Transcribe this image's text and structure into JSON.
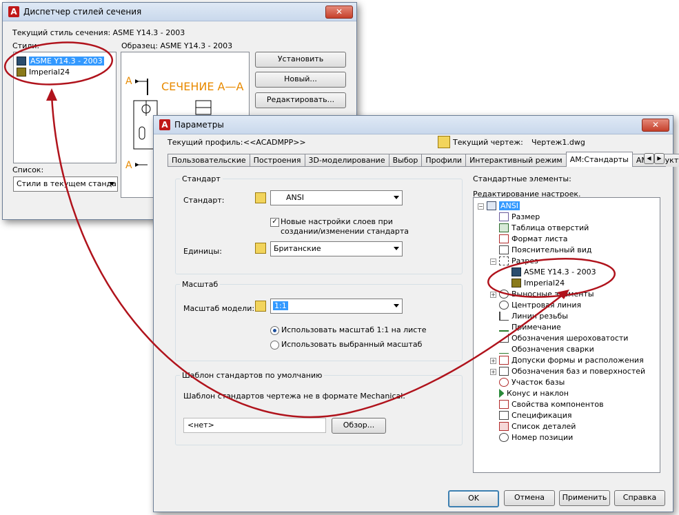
{
  "section_manager": {
    "title": "Диспетчер стилей сечения",
    "current_style_label": "Текущий стиль сечения: ASME Y14.3 - 2003",
    "styles_label": "Стили:",
    "styles": [
      "ASME Y14.3 - 2003",
      "Imperial24"
    ],
    "sample_label": "Образец: ASME Y14.3 - 2003",
    "preview_text": "СЕЧЕНИЕ А—А",
    "preview_letter": "А",
    "buttons": {
      "set": "Установить",
      "new": "Новый...",
      "edit": "Редактировать..."
    },
    "list_label": "Список:",
    "list_value": "Стили в текущем станда"
  },
  "options": {
    "title": "Параметры",
    "current_profile_label": "Текущий профиль:",
    "current_profile_value": "<<ACADMPP>>",
    "current_drawing_label": "Текущий чертеж:",
    "current_drawing_value": "Чертеж1.dwg",
    "tabs": [
      "Пользовательские",
      "Построения",
      "3D-моделирование",
      "Выбор",
      "Профили",
      "Интерактивный режим",
      "AM:Стандарты",
      "AM:Структуры",
      "A"
    ],
    "standard_group": "Стандарт",
    "standard_label": "Стандарт:",
    "standard_value": "ANSI",
    "layers_checkbox": "Новые настройки слоев при созданииизменении стандарта",
    "layers_line1": "Новые настройки слоев при",
    "layers_line2": "создании/изменении стандарта",
    "units_label": "Единицы:",
    "units_value": "Британские",
    "scale_group": "Масштаб",
    "model_scale_label": "Масштаб модели:",
    "model_scale_value": "1:1",
    "radio_use_1_1": "Использовать масштаб 1:1 на листе",
    "radio_use_selected": "Использовать выбранный масштаб",
    "template_group": "Шаблон стандартов по умолчанию",
    "template_label": "Шаблон стандартов чертежа не в формате Mechanical:",
    "template_value": "<нет>",
    "browse_button": "Обзор...",
    "std_elements_label": "Стандартные элементы:",
    "edit_settings_label": "Редактирование настроек.",
    "tree": {
      "root": "ANSI",
      "items": [
        "Размер",
        "Таблица отверстий",
        "Формат листа",
        "Пояснительный вид",
        "Разрез",
        "ASME Y14.3 - 2003",
        "Imperial24",
        "Выносные элементы",
        "Центровая линия",
        "Линии резьбы",
        "Примечание",
        "Обозначения шероховатости",
        "Обозначения сварки",
        "Допуски формы и расположения",
        "Обозначения баз и поверхностей",
        "Участок базы",
        "Конус и наклон",
        "Свойства компонентов",
        "Спецификация",
        "Список деталей",
        "Номер позиции"
      ]
    },
    "buttons": {
      "ok": "OK",
      "cancel": "Отмена",
      "apply": "Применить",
      "help": "Справка"
    }
  },
  "colors": {
    "annotation": "#b0131c",
    "accent": "#e88a00",
    "selection": "#3399ff"
  }
}
